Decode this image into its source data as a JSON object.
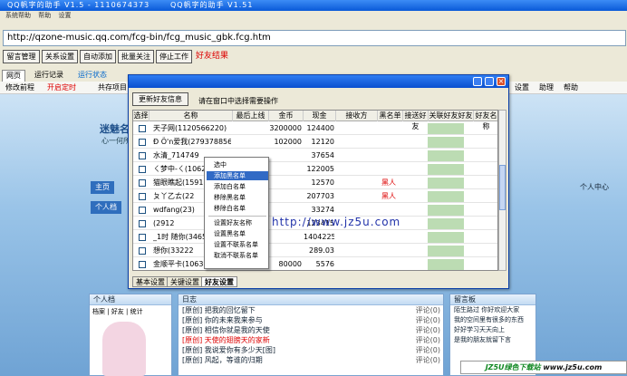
{
  "window": {
    "title_left": "QQ帆字的助手 V1.5 - 1110674373",
    "title_right": "QQ帆字的助手 V1.51"
  },
  "menu": [
    "系统帮助",
    "帮助",
    "设置"
  ],
  "url": "http://qzone-music.qq.com/fcg-bin/fcg_music_gbk.fcg.htm",
  "toolbar": {
    "buttons": [
      "留言管理",
      "关系设置",
      "自动添加",
      "批量关注",
      "停止工作"
    ],
    "link": "好友结果"
  },
  "browser": {
    "tabs": [
      {
        "label": "网页",
        "active": true
      },
      {
        "label": "运行记录"
      },
      {
        "label": "运行状态"
      }
    ],
    "addr_items": [
      "修改前程",
      "开启定时",
      "共存项目"
    ],
    "addr_right": [
      "设置",
      "助理",
      "帮助"
    ],
    "blog_title": "迷魅名",
    "blog_subtitle": "心一何所有",
    "nav": [
      "主页",
      "个人档"
    ],
    "right_nav": "个人中心"
  },
  "personal_panel": {
    "title": "个人档",
    "tabs": [
      "档案",
      "好友",
      "统计"
    ]
  },
  "log_panel": {
    "title": "日志",
    "items": [
      {
        "text": "[原创] 把我的回忆留下",
        "right": "评论(0)"
      },
      {
        "text": "[原创] 你的未来我来参与",
        "right": "评论(0)"
      },
      {
        "text": "[原创] 相信你就是我的天使",
        "right": "评论(0)"
      },
      {
        "text": "[原创] 天使的翅膀天的家新",
        "right": "评论(0)",
        "new": true
      },
      {
        "text": "[原创] 我说爱你有多少天[图]",
        "right": "评论(0)"
      },
      {
        "text": "[原创] 风起，等谁的归期",
        "right": "评论(0)"
      }
    ]
  },
  "guest_panel": {
    "title": "留言板",
    "items": [
      "陌生路过 你好欢迎大家",
      "我的空间里有很多的东西",
      "好好学习天天向上",
      "是我的朋友就留下言"
    ]
  },
  "dialog": {
    "button": "更新好友信息",
    "label": "请在窗口中选择需要操作",
    "columns": [
      "选择",
      "名称",
      "最后上线",
      "金币",
      "现金",
      "接收方",
      "黑名单",
      "接送好友",
      "关联好友好友分组",
      "好友名称"
    ],
    "rows": [
      {
        "name": "天子网(1120566220)",
        "last": "",
        "gold": "3200000",
        "cash": "124400"
      },
      {
        "name": "Ð Ö'n爱我(279378856)",
        "last": "",
        "gold": "102000",
        "cash": "12120"
      },
      {
        "name": "水清_714749",
        "last": "",
        "gold": "",
        "cash": "37654"
      },
      {
        "name": "ㄑ梦中-ㄑ(1062)",
        "last": "",
        "gold": "",
        "cash": "122005"
      },
      {
        "name": "猫眼瞧起(1591",
        "last": "",
        "gold": "",
        "cash": "12570",
        "black": "黑人"
      },
      {
        "name": "ㄆ丫乙ㄊ(22",
        "last": "",
        "gold": "",
        "cash": "207703",
        "black": "黑人"
      },
      {
        "name": "wdfang(23)",
        "last": "",
        "gold": "",
        "cash": "33274"
      },
      {
        "name": "(2912",
        "last": "",
        "gold": "",
        "cash": "123415"
      },
      {
        "name": "_1时 随你(34659",
        "last": "",
        "gold": "",
        "cash": "1404225"
      },
      {
        "name": "想你(33222",
        "last": "",
        "gold": "",
        "cash": "289.03"
      },
      {
        "name": "金顺平卡(1063085)",
        "last": "缺",
        "gold": "80000",
        "cash": "5576"
      }
    ],
    "tabs": [
      {
        "label": "基本设置"
      },
      {
        "label": "关键设置"
      },
      {
        "label": "好友设置",
        "active": true
      }
    ]
  },
  "context_menu": [
    "选中",
    "添加黑名单",
    "添加白名单",
    "移除黑名单",
    "移除白名单",
    "设置好友名称",
    "设置黑名单",
    "设置不联系名单",
    "取消不联系名单"
  ],
  "watermark": "http://www.jz5u.com",
  "badge": {
    "a": "JZ5U绿色下载站",
    "b": "www.jz5u.com"
  }
}
